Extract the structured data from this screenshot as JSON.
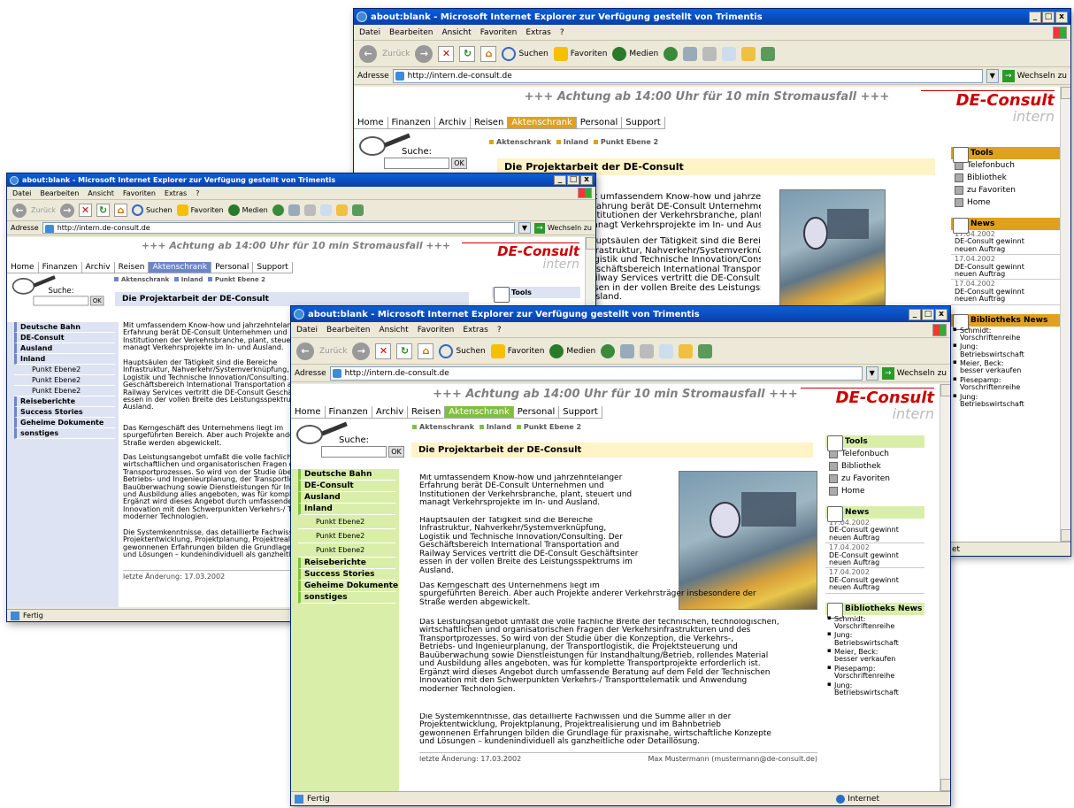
{
  "window": {
    "title": "about:blank - Microsoft Internet Explorer  zur Verfügung gestellt von Trimentis",
    "controls": [
      "_",
      "□",
      "x"
    ]
  },
  "menu": [
    "Datei",
    "Bearbeiten",
    "Ansicht",
    "Favoriten",
    "Extras",
    "?"
  ],
  "toolbar": {
    "back": "Zurück",
    "search": "Suchen",
    "favorites": "Favoriten",
    "media": "Medien"
  },
  "address": {
    "label": "Adresse",
    "url": "http://intern.de-consult.de",
    "go": "Wechseln zu"
  },
  "page": {
    "warning": "+++ Achtung ab 14:00 Uhr für 10 min Stromausfall +++",
    "logo_main": "DE-Consult",
    "logo_sub": "intern",
    "nav": [
      "Home",
      "Finanzen",
      "Archiv",
      "Reisen",
      "Aktenschrank",
      "Personal",
      "Support"
    ],
    "search_label": "Suche:",
    "search_ok": "OK",
    "breadcrumb": [
      "Aktenschrank",
      "Inland",
      "Punkt Ebene 2"
    ],
    "title": "Die Projektarbeit der DE-Consult",
    "leftnav": [
      {
        "label": "Deutsche Bahn",
        "sub": false
      },
      {
        "label": "DE-Consult",
        "sub": false
      },
      {
        "label": "Ausland",
        "sub": false
      },
      {
        "label": "Inland",
        "sub": false
      },
      {
        "label": "Punkt Ebene2",
        "sub": true
      },
      {
        "label": "Punkt Ebene2",
        "sub": true
      },
      {
        "label": "Punkt Ebene2",
        "sub": true
      },
      {
        "label": "Reiseberichte",
        "sub": false
      },
      {
        "label": "Success Stories",
        "sub": false
      },
      {
        "label": "Geheime Dokumente",
        "sub": false
      },
      {
        "label": "sonstiges",
        "sub": false
      }
    ],
    "p1": "Mit umfassendem Know-how und jahrzehntelanger\nErfahrung berät DE-Consult Unternehmen und\nInstitutionen der Verkehrsbranche, plant, steuert und\nmanagt Verkehrsprojekte im In- und Ausland.",
    "p2": "Hauptsäulen der Tätigkeit sind die Bereiche\nInfrastruktur, Nahverkehr/Systemverknüpfung,\nLogistik und Technische Innovation/Consulting. Der\nGeschäftsbereich International Transportation and\nRailway Services vertritt die DE-Consult Geschäftsinter\nessen in der vollen Breite des Leistungsspektrums im\nAusland.",
    "p3": "Das Kerngeschäft des Unternehmens liegt im\nspurgeführten Bereich. Aber auch Projekte anderer Verkehrsträger insbesondere der\nStraße werden abgewickelt.",
    "p4": "Das Leistungsangebot umfaßt die volle fachliche Breite der technischen, technologischen,\nwirtschaftlichen und organisatorischen Fragen der Verkehrsinfrastrukturen und des\nTransportprozesses. So wird von der Studie über die Konzeption, die Verkehrs-,\nBetriebs- und Ingenieurplanung, der Transportlogistik, die Projektsteuerung und\nBauüberwachung sowie Dienstleistungen für Instandhaltung/Betrieb, rollendes Material\nund Ausbildung alles angeboten, was für komplette Transportprojekte erforderlich ist.\nErgänzt wird dieses Angebot durch umfassende Beratung auf dem Feld der Technischen\nInnovation mit den Schwerpunkten Verkehrs-/ Transporttelematik und Anwendung\nmoderner Technologien.",
    "p5": "Die Systemkenntnisse, das detaillierte Fachwissen und die Summe aller in der\nProjektentwicklung, Projektplanung, Projektrealisierung und im Bahnbetrieb\ngewonnenen Erfahrungen bilden die Grundlage für praxisnahe, wirtschaftliche Konzepte\nund Lösungen – kundenindividuell als ganzheitliche oder Detaillösung.",
    "last_change": "letzte Änderung: 17.03.2002",
    "author": "Max Mustermann (mustermann@de-consult.de)",
    "tools_title": "Tools",
    "tools": [
      "Telefonbuch",
      "Bibliothek",
      "zu Favoriten",
      "Home"
    ],
    "news_title": "News",
    "news": [
      {
        "date": "17.04.2002",
        "text": "DE-Consult gewinnt\nneuen Auftrag"
      },
      {
        "date": "17.04.2002",
        "text": "DE-Consult gewinnt\nneuen Auftrag"
      },
      {
        "date": "17.04.2002",
        "text": "DE-Consult gewinnt\nneuen Auftrag"
      }
    ],
    "lib_title": "Bibliotheks News",
    "lib": [
      "Schmidt:\nVorschriftenreihe",
      "Jung:\nBetriebswirtschaft",
      "Meier, Beck:\nbesser verkaufen",
      "Piesepamp:\nVorschriftenreihe",
      "Jung:\nBetriebswirtschaft"
    ]
  },
  "status": {
    "left": "Fertig",
    "zone": "Internet",
    "back_fragment": "et"
  },
  "colors": {
    "orange_accent": "#e0a020",
    "blue_accent": "#6c86c8",
    "green_accent": "#7fbf3f",
    "green_nav_bg": "#d9efa9",
    "blue_nav_bg": "#dde3f3",
    "orange_nav_bg": "#fff3c8"
  }
}
